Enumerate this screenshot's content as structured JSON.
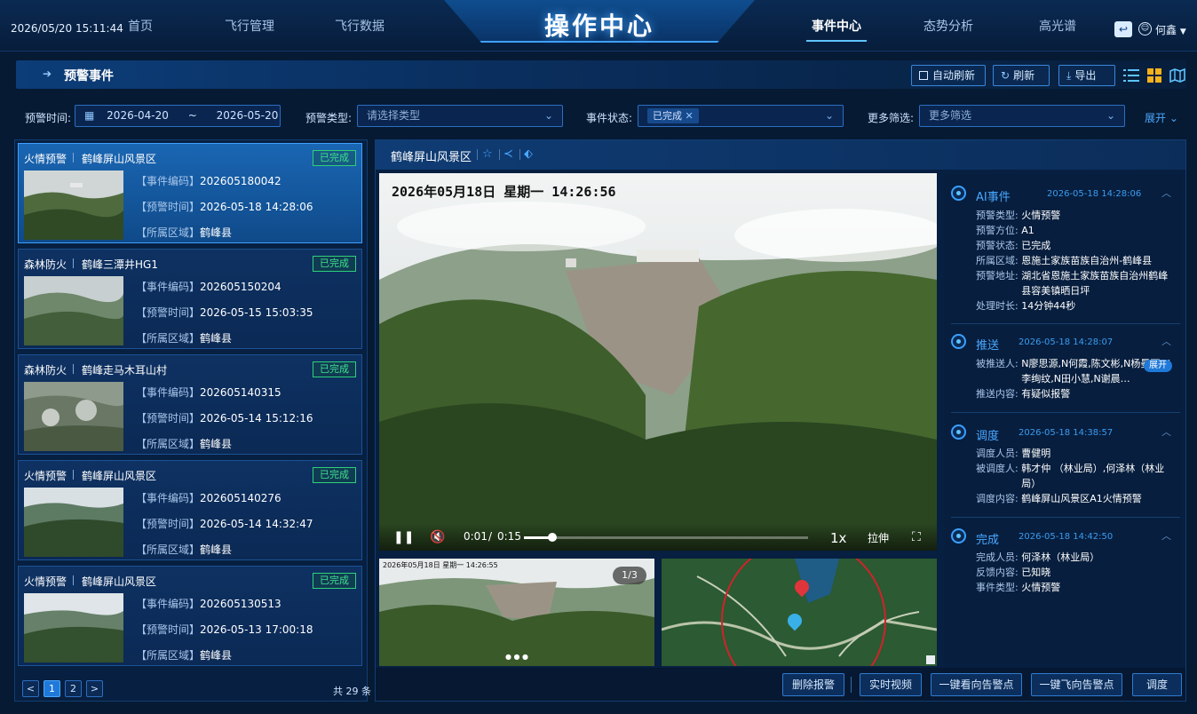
{
  "header": {
    "datetime": "2026/05/20 15:11:44",
    "app_title": "操作中心",
    "nav_left": [
      "首页",
      "飞行管理",
      "飞行数据"
    ],
    "nav_right": [
      "事件中心",
      "态势分析",
      "高光谱"
    ],
    "active_nav": "事件中心",
    "user_name": "何鑫",
    "icons": [
      "back-icon",
      "user-icon",
      "chevron-down-icon"
    ]
  },
  "page": {
    "title": "预警事件",
    "auto_refresh_label": "自动刷新",
    "refresh_label": "刷新",
    "export_label": "导出"
  },
  "filters": {
    "time_label": "预警时间:",
    "date_from": "2026-04-20",
    "date_sep": "~",
    "date_to": "2026-05-20",
    "type_label": "预警类型:",
    "type_placeholder": "请选择类型",
    "status_label": "事件状态:",
    "status_value": "已完成",
    "more_label": "更多筛选:",
    "more_placeholder": "更多筛选",
    "expand_label": "展开"
  },
  "events": [
    {
      "type": "火情预警",
      "place": "鹤峰屏山风景区",
      "status": "已完成",
      "code_key": "【事件编码】",
      "code": "202605180042",
      "time_key": "【预警时间】",
      "time": "2026-05-18 14:28:06",
      "area_key": "【所属区域】",
      "area": "鹤峰县"
    },
    {
      "type": "森林防火",
      "place": "鹤峰三潭井HG1",
      "status": "已完成",
      "code_key": "【事件编码】",
      "code": "202605150204",
      "time_key": "【预警时间】",
      "time": "2026-05-15 15:03:35",
      "area_key": "【所属区域】",
      "area": "鹤峰县"
    },
    {
      "type": "森林防火",
      "place": "鹤峰走马木耳山村",
      "status": "已完成",
      "code_key": "【事件编码】",
      "code": "202605140315",
      "time_key": "【预警时间】",
      "time": "2026-05-14 15:12:16",
      "area_key": "【所属区域】",
      "area": "鹤峰县"
    },
    {
      "type": "火情预警",
      "place": "鹤峰屏山风景区",
      "status": "已完成",
      "code_key": "【事件编码】",
      "code": "202605140276",
      "time_key": "【预警时间】",
      "time": "2026-05-14 14:32:47",
      "area_key": "【所属区域】",
      "area": "鹤峰县"
    },
    {
      "type": "火情预警",
      "place": "鹤峰屏山风景区",
      "status": "已完成",
      "code_key": "【事件编码】",
      "code": "202605130513",
      "time_key": "【预警时间】",
      "time": "2026-05-13 17:00:18",
      "area_key": "【所属区域】",
      "area": "鹤峰县"
    }
  ],
  "pagination": {
    "prev": "<",
    "pages": [
      "1",
      "2"
    ],
    "next": ">",
    "total": "共 29 条"
  },
  "detail": {
    "title": "鹤峰屏山风景区",
    "osd_text": "2026年05月18日  星期一  14:26:56",
    "current_time": "0:01",
    "time_sep": "/",
    "duration": "0:15",
    "progress": 0.1,
    "speed": "1x",
    "stretch_label": "拉伸",
    "thumb_osd": "2026年05月18日 星期一 14:26:55",
    "image_counter": "1/3"
  },
  "timeline": {
    "ai": {
      "title": "AI事件",
      "time": "2026-05-18 14:28:06",
      "rows": [
        {
          "k": "预警类型:",
          "v": "火情预警"
        },
        {
          "k": "预警方位:",
          "v": "A1"
        },
        {
          "k": "预警状态:",
          "v": "已完成"
        },
        {
          "k": "所属区域:",
          "v": "恩施土家族苗族自治州-鹤峰县"
        },
        {
          "k": "预警地址:",
          "v": "湖北省恩施土家族苗族自治州鹤峰县容美镇晒日坪"
        },
        {
          "k": "处理时长:",
          "v": "14分钟44秒"
        }
      ]
    },
    "push": {
      "title": "推送",
      "time": "2026-05-18 14:28:07",
      "recipients_key": "被推送人:",
      "recipients": "N廖思源,N何霞,陈文彬,N杨曼丽,N李绚纹,N田小慧,N谢晨…",
      "expand": "展开",
      "content_key": "推送内容:",
      "content": "有疑似报警"
    },
    "dispatch": {
      "title": "调度",
      "time": "2026-05-18 14:38:57",
      "rows": [
        {
          "k": "调度人员:",
          "v": "曹健明"
        },
        {
          "k": "被调度人:",
          "v": "韩才仲 （林业局）,何泽林（林业局）"
        },
        {
          "k": "调度内容:",
          "v": "鹤峰屏山风景区A1火情预警"
        }
      ]
    },
    "done": {
      "title": "完成",
      "time": "2026-05-18 14:42:50",
      "rows": [
        {
          "k": "完成人员:",
          "v": "何泽林（林业局）"
        },
        {
          "k": "反馈内容:",
          "v": "已知晓"
        },
        {
          "k": "事件类型:",
          "v": "火情预警"
        }
      ]
    }
  },
  "actions": [
    "删除报警",
    "实时视频",
    "一键看向告警点",
    "一键飞向告警点",
    "调度"
  ],
  "colors": {
    "accent": "#1f79d8",
    "status_done": "#3fe08c",
    "background": "#061a33"
  }
}
